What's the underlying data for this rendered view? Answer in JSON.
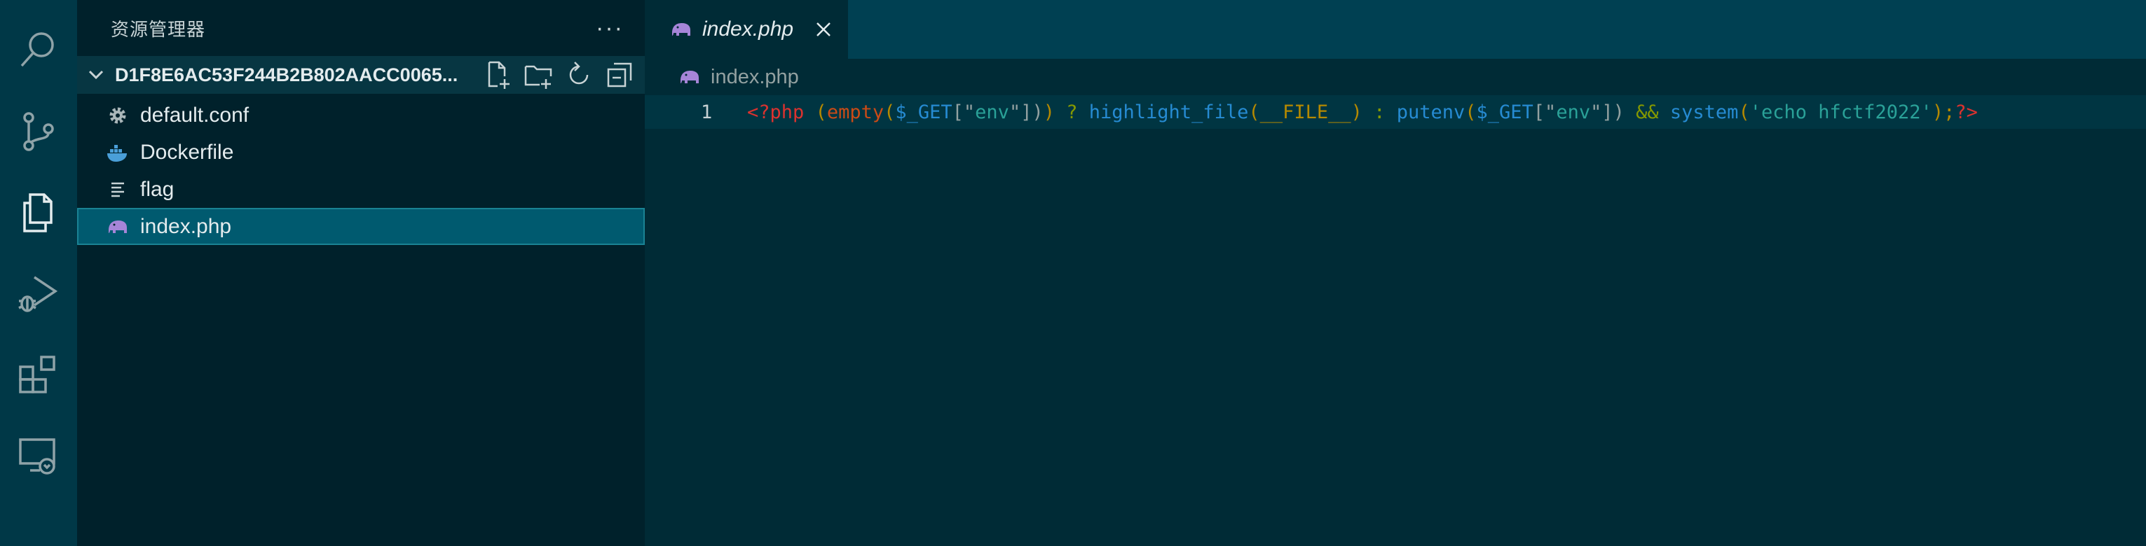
{
  "sidebar": {
    "title": "资源管理器",
    "more_label": "···",
    "folder_name": "D1F8E6AC53F244B2B802AACC0065...",
    "files": [
      {
        "name": "default.conf",
        "icon": "gear-icon"
      },
      {
        "name": "Dockerfile",
        "icon": "docker-icon"
      },
      {
        "name": "flag",
        "icon": "text-file-icon"
      },
      {
        "name": "index.php",
        "icon": "php-elephant-icon",
        "selected": true
      }
    ]
  },
  "activity_bar": {
    "items": [
      "search-icon",
      "source-control-icon",
      "explorer-icon",
      "run-debug-icon",
      "extensions-icon",
      "remote-explorer-icon"
    ],
    "active": "explorer-icon"
  },
  "editor": {
    "tab_label": "index.php",
    "breadcrumb": "index.php",
    "line_number": "1",
    "code": {
      "t1": "<?php",
      "t2": " ",
      "t3": "(",
      "t4": "empty",
      "t5": "(",
      "t6": "$_GET",
      "t7": "[\"",
      "t8": "env",
      "t9": "\"])",
      "t10": ")",
      "t11": " ? ",
      "t12": "highlight_file",
      "t13": "(",
      "t14": "__FILE__",
      "t15": ")",
      "t16": " : ",
      "t17": "putenv",
      "t18": "(",
      "t19": "$_GET",
      "t20": "[\"",
      "t21": "env",
      "t22": "\"])",
      "t23": " && ",
      "t24": "system",
      "t25": "(",
      "t26": "'echo hfctf2022'",
      "t27": ");",
      "t28": "?>"
    }
  },
  "colors": {
    "background": "#002b36",
    "sidebar": "#00212b",
    "activity_bar": "#003847",
    "selection": "#005a6f",
    "accent": "#268bd2"
  }
}
